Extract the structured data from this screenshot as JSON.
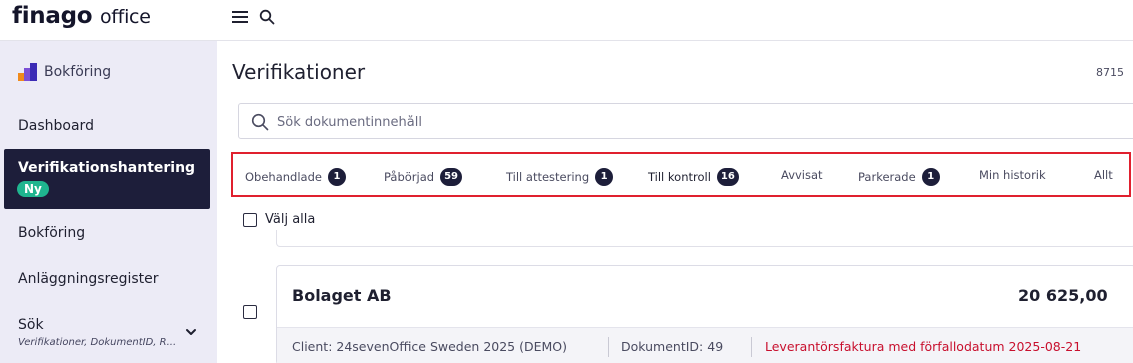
{
  "app": {
    "logo_main": "finago",
    "logo_sub": "office"
  },
  "sidebar": {
    "module": "Bokföring",
    "items": [
      {
        "label": "Dashboard"
      },
      {
        "label": "Verifikationshantering",
        "badge": "Ny",
        "active": true
      },
      {
        "label": "Bokföring"
      },
      {
        "label": "Anläggningsregister"
      },
      {
        "label": "Sök",
        "sublabel": "Verifikationer, DokumentID, R..."
      }
    ]
  },
  "page": {
    "title": "Verifikationer",
    "count": "8715"
  },
  "search": {
    "placeholder": "Sök dokumentinnehåll"
  },
  "tabs": [
    {
      "label": "Obehandlade",
      "count": "1"
    },
    {
      "label": "Påbörjad",
      "count": "59"
    },
    {
      "label": "Till attestering",
      "count": "1"
    },
    {
      "label": "Till kontroll",
      "count": "16",
      "selected": true
    },
    {
      "label": "Avvisat"
    },
    {
      "label": "Parkerade",
      "count": "1"
    },
    {
      "label": "Min historik"
    },
    {
      "label": "Allt"
    }
  ],
  "list": {
    "select_all_label": "Välj alla",
    "items": [
      {
        "company": "Bolaget AB",
        "amount": "20 625,00",
        "client": "Client: 24sevenOffice Sweden 2025 (DEMO)",
        "document_id": "DokumentID: 49",
        "warning": "Leverantörsfaktura med förfallodatum 2025-08-21"
      }
    ]
  },
  "colors": {
    "sidebar_bg": "#ecebf6",
    "active_bg": "#1d1e3a",
    "badge_green": "#1fb58f",
    "highlight_red": "#e0202e",
    "warning_red": "#c8102e"
  },
  "icons": {
    "menu": "hamburger-icon",
    "search": "search-icon",
    "module": "bookkeeping-bars-icon",
    "expand": "chevron-down-icon"
  }
}
